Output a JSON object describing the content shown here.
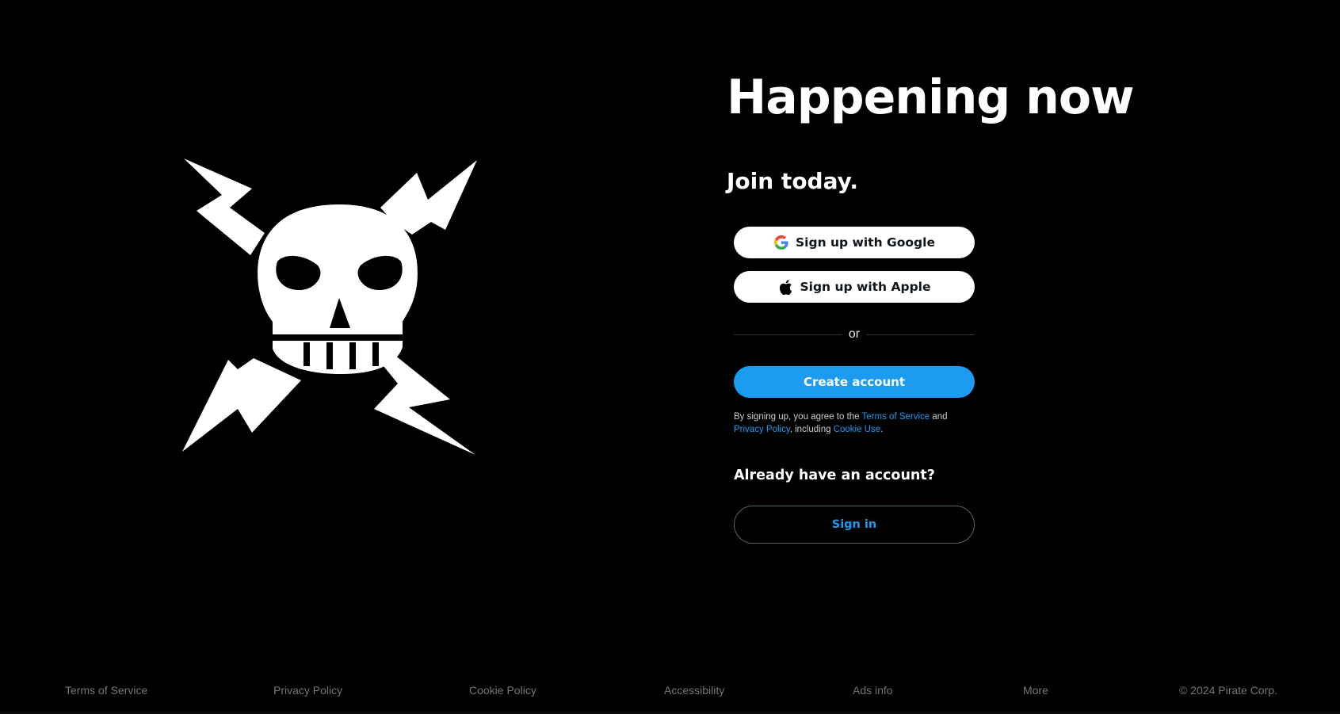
{
  "hero": {
    "logo_icon": "skull-lightning-logo-icon",
    "headline": "Happening now",
    "subheadline": "Join today."
  },
  "signup": {
    "google_label": "Sign up with Google",
    "google_icon": "google-g-icon",
    "apple_label": "Sign up with Apple",
    "apple_icon": "apple-icon",
    "or_label": "or",
    "create_label": "Create account",
    "terms": {
      "prefix": "By signing up, you agree to the ",
      "tos_link": "Terms of Service",
      "and": " and",
      "privacy_link": "Privacy Policy",
      "including": ", including ",
      "cookie_link": "Cookie Use",
      "period": "."
    }
  },
  "signin": {
    "prompt": "Already have an account?",
    "button_label": "Sign in"
  },
  "footer": {
    "links": [
      "Terms of Service",
      "Privacy Policy",
      "Cookie Policy",
      "Accessibility",
      "Ads info",
      "More"
    ],
    "copyright": "© 2024 Pirate Corp."
  },
  "colors": {
    "background": "#000000",
    "accent": "#1d9bf0",
    "text": "#e7e9ea",
    "muted": "#71767b",
    "button_white": "#ffffff"
  }
}
